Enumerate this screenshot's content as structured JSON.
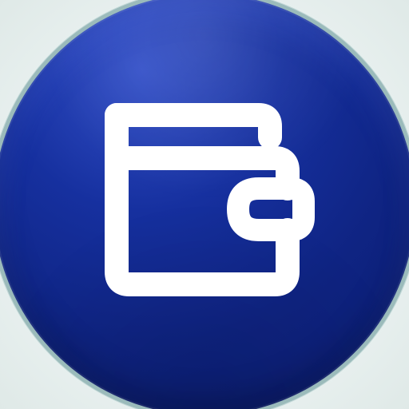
{
  "app_icon": {
    "icon": "wallet-icon",
    "background_color": "#0f2483",
    "foreground_color": "#ffffff",
    "ring_color": "#9bbbbb"
  }
}
